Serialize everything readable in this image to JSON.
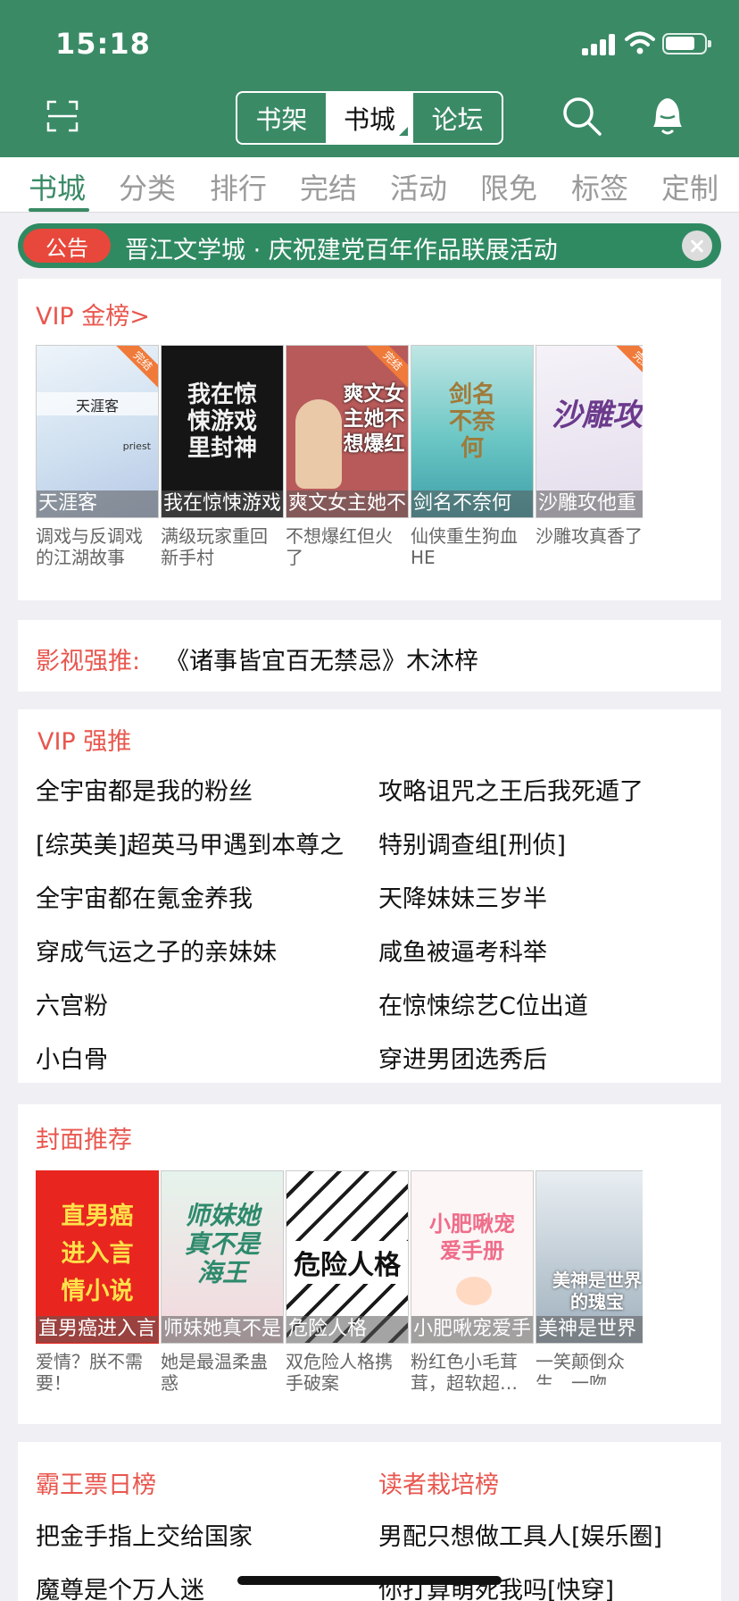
{
  "status": {
    "time": "15:18"
  },
  "header": {
    "segments": [
      "书架",
      "书城",
      "论坛"
    ],
    "active_segment": 1
  },
  "tabs": [
    "书城",
    "分类",
    "排行",
    "完结",
    "活动",
    "限免",
    "标签",
    "定制"
  ],
  "notice": {
    "badge": "公告",
    "text": "晋江文学城 · 庆祝建党百年作品联展活动"
  },
  "vip_gold": {
    "title": "VIP 金榜>",
    "books": [
      {
        "band": "天涯客",
        "desc": "调戏与反调戏的江湖故事",
        "cover_text": "天涯客",
        "cover_sub": "priest",
        "ribbon": "完结"
      },
      {
        "band": "我在惊悚游戏",
        "desc": "满级玩家重回新手村",
        "cover_text": "我在惊悚游戏里封神"
      },
      {
        "band": "爽文女主她不",
        "desc": "不想爆红但火了",
        "cover_text": "爽文女主她不想爆红",
        "ribbon": "完结"
      },
      {
        "band": "剑名不奈何",
        "desc": "仙侠重生狗血HE",
        "cover_text": "剑名不奈何"
      },
      {
        "band": "沙雕攻他重",
        "desc": "沙雕攻真香了",
        "cover_text": "沙雕攻",
        "ribbon": "完结"
      }
    ]
  },
  "film": {
    "label": "影视强推:",
    "text": "《诸事皆宜百无禁忌》木沐梓"
  },
  "vip_push": {
    "title": "VIP 强推",
    "left": [
      "全宇宙都是我的粉丝",
      "[综英美]超英马甲遇到本尊之",
      "全宇宙都在氪金养我",
      "穿成气运之子的亲妹妹",
      "六宫粉",
      "小白骨"
    ],
    "right": [
      "攻略诅咒之王后我死遁了",
      "特别调查组[刑侦]",
      "天降妹妹三岁半",
      "咸鱼被逼考科举",
      "在惊悚综艺C位出道",
      "穿进男团选秀后"
    ]
  },
  "cover_rec": {
    "title": "封面推荐",
    "books": [
      {
        "band": "直男癌进入言",
        "desc": "爱情？朕不需要！",
        "cover_text": "直男癌进入言情小说"
      },
      {
        "band": "师妹她真不是",
        "desc": "她是最温柔蛊惑",
        "cover_text": "师妹她真不是海王"
      },
      {
        "band": "危险人格",
        "desc": "双危险人格携手破案",
        "cover_text": "危险人格"
      },
      {
        "band": "小肥啾宠爱手",
        "desc": "粉红色小毛茸茸，超软超…",
        "cover_text": "小肥啾宠爱手册"
      },
      {
        "band": "美神是世界",
        "desc": "一笑颠倒众生，一吻便…",
        "cover_text": "美神是世界的瑰宝"
      }
    ]
  },
  "bawang": {
    "title": "霸王票日榜",
    "items": [
      "把金手指上交给国家",
      "魔尊是个万人迷"
    ]
  },
  "reader": {
    "title": "读者栽培榜",
    "items": [
      "男配只想做工具人[娱乐圈]",
      "你打算萌死我吗[快穿]"
    ]
  },
  "colors": {
    "primary": "#3a8a66",
    "accent": "#e8574f",
    "notice_badge": "#e8483b"
  }
}
